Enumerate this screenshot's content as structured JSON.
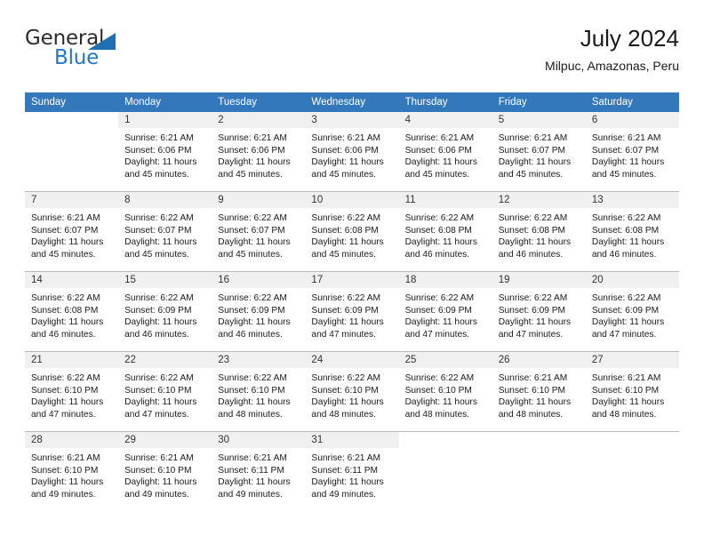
{
  "brand": {
    "name_top": "General",
    "name_bottom": "Blue",
    "triangle_color": "#1f6fb5",
    "blue_color": "#2277c8"
  },
  "header": {
    "title": "July 2024",
    "subtitle": "Milpuc, Amazonas, Peru"
  },
  "theme": {
    "header_bg": "#3478bc",
    "daynum_bg": "#f0f0f0",
    "row_divider": "#b9b9b9"
  },
  "weekday_headers": [
    "Sunday",
    "Monday",
    "Tuesday",
    "Wednesday",
    "Thursday",
    "Friday",
    "Saturday"
  ],
  "weeks": [
    {
      "days": [
        {
          "num": "",
          "empty": true,
          "sunrise": "",
          "sunset": "",
          "daylight_1": "",
          "daylight_2": ""
        },
        {
          "num": "1",
          "sunrise": "Sunrise: 6:21 AM",
          "sunset": "Sunset: 6:06 PM",
          "daylight_1": "Daylight: 11 hours",
          "daylight_2": "and 45 minutes."
        },
        {
          "num": "2",
          "sunrise": "Sunrise: 6:21 AM",
          "sunset": "Sunset: 6:06 PM",
          "daylight_1": "Daylight: 11 hours",
          "daylight_2": "and 45 minutes."
        },
        {
          "num": "3",
          "sunrise": "Sunrise: 6:21 AM",
          "sunset": "Sunset: 6:06 PM",
          "daylight_1": "Daylight: 11 hours",
          "daylight_2": "and 45 minutes."
        },
        {
          "num": "4",
          "sunrise": "Sunrise: 6:21 AM",
          "sunset": "Sunset: 6:06 PM",
          "daylight_1": "Daylight: 11 hours",
          "daylight_2": "and 45 minutes."
        },
        {
          "num": "5",
          "sunrise": "Sunrise: 6:21 AM",
          "sunset": "Sunset: 6:07 PM",
          "daylight_1": "Daylight: 11 hours",
          "daylight_2": "and 45 minutes."
        },
        {
          "num": "6",
          "sunrise": "Sunrise: 6:21 AM",
          "sunset": "Sunset: 6:07 PM",
          "daylight_1": "Daylight: 11 hours",
          "daylight_2": "and 45 minutes."
        }
      ]
    },
    {
      "days": [
        {
          "num": "7",
          "sunrise": "Sunrise: 6:21 AM",
          "sunset": "Sunset: 6:07 PM",
          "daylight_1": "Daylight: 11 hours",
          "daylight_2": "and 45 minutes."
        },
        {
          "num": "8",
          "sunrise": "Sunrise: 6:22 AM",
          "sunset": "Sunset: 6:07 PM",
          "daylight_1": "Daylight: 11 hours",
          "daylight_2": "and 45 minutes."
        },
        {
          "num": "9",
          "sunrise": "Sunrise: 6:22 AM",
          "sunset": "Sunset: 6:07 PM",
          "daylight_1": "Daylight: 11 hours",
          "daylight_2": "and 45 minutes."
        },
        {
          "num": "10",
          "sunrise": "Sunrise: 6:22 AM",
          "sunset": "Sunset: 6:08 PM",
          "daylight_1": "Daylight: 11 hours",
          "daylight_2": "and 45 minutes."
        },
        {
          "num": "11",
          "sunrise": "Sunrise: 6:22 AM",
          "sunset": "Sunset: 6:08 PM",
          "daylight_1": "Daylight: 11 hours",
          "daylight_2": "and 46 minutes."
        },
        {
          "num": "12",
          "sunrise": "Sunrise: 6:22 AM",
          "sunset": "Sunset: 6:08 PM",
          "daylight_1": "Daylight: 11 hours",
          "daylight_2": "and 46 minutes."
        },
        {
          "num": "13",
          "sunrise": "Sunrise: 6:22 AM",
          "sunset": "Sunset: 6:08 PM",
          "daylight_1": "Daylight: 11 hours",
          "daylight_2": "and 46 minutes."
        }
      ]
    },
    {
      "days": [
        {
          "num": "14",
          "sunrise": "Sunrise: 6:22 AM",
          "sunset": "Sunset: 6:08 PM",
          "daylight_1": "Daylight: 11 hours",
          "daylight_2": "and 46 minutes."
        },
        {
          "num": "15",
          "sunrise": "Sunrise: 6:22 AM",
          "sunset": "Sunset: 6:09 PM",
          "daylight_1": "Daylight: 11 hours",
          "daylight_2": "and 46 minutes."
        },
        {
          "num": "16",
          "sunrise": "Sunrise: 6:22 AM",
          "sunset": "Sunset: 6:09 PM",
          "daylight_1": "Daylight: 11 hours",
          "daylight_2": "and 46 minutes."
        },
        {
          "num": "17",
          "sunrise": "Sunrise: 6:22 AM",
          "sunset": "Sunset: 6:09 PM",
          "daylight_1": "Daylight: 11 hours",
          "daylight_2": "and 47 minutes."
        },
        {
          "num": "18",
          "sunrise": "Sunrise: 6:22 AM",
          "sunset": "Sunset: 6:09 PM",
          "daylight_1": "Daylight: 11 hours",
          "daylight_2": "and 47 minutes."
        },
        {
          "num": "19",
          "sunrise": "Sunrise: 6:22 AM",
          "sunset": "Sunset: 6:09 PM",
          "daylight_1": "Daylight: 11 hours",
          "daylight_2": "and 47 minutes."
        },
        {
          "num": "20",
          "sunrise": "Sunrise: 6:22 AM",
          "sunset": "Sunset: 6:09 PM",
          "daylight_1": "Daylight: 11 hours",
          "daylight_2": "and 47 minutes."
        }
      ]
    },
    {
      "days": [
        {
          "num": "21",
          "sunrise": "Sunrise: 6:22 AM",
          "sunset": "Sunset: 6:10 PM",
          "daylight_1": "Daylight: 11 hours",
          "daylight_2": "and 47 minutes."
        },
        {
          "num": "22",
          "sunrise": "Sunrise: 6:22 AM",
          "sunset": "Sunset: 6:10 PM",
          "daylight_1": "Daylight: 11 hours",
          "daylight_2": "and 47 minutes."
        },
        {
          "num": "23",
          "sunrise": "Sunrise: 6:22 AM",
          "sunset": "Sunset: 6:10 PM",
          "daylight_1": "Daylight: 11 hours",
          "daylight_2": "and 48 minutes."
        },
        {
          "num": "24",
          "sunrise": "Sunrise: 6:22 AM",
          "sunset": "Sunset: 6:10 PM",
          "daylight_1": "Daylight: 11 hours",
          "daylight_2": "and 48 minutes."
        },
        {
          "num": "25",
          "sunrise": "Sunrise: 6:22 AM",
          "sunset": "Sunset: 6:10 PM",
          "daylight_1": "Daylight: 11 hours",
          "daylight_2": "and 48 minutes."
        },
        {
          "num": "26",
          "sunrise": "Sunrise: 6:21 AM",
          "sunset": "Sunset: 6:10 PM",
          "daylight_1": "Daylight: 11 hours",
          "daylight_2": "and 48 minutes."
        },
        {
          "num": "27",
          "sunrise": "Sunrise: 6:21 AM",
          "sunset": "Sunset: 6:10 PM",
          "daylight_1": "Daylight: 11 hours",
          "daylight_2": "and 48 minutes."
        }
      ]
    },
    {
      "days": [
        {
          "num": "28",
          "sunrise": "Sunrise: 6:21 AM",
          "sunset": "Sunset: 6:10 PM",
          "daylight_1": "Daylight: 11 hours",
          "daylight_2": "and 49 minutes."
        },
        {
          "num": "29",
          "sunrise": "Sunrise: 6:21 AM",
          "sunset": "Sunset: 6:10 PM",
          "daylight_1": "Daylight: 11 hours",
          "daylight_2": "and 49 minutes."
        },
        {
          "num": "30",
          "sunrise": "Sunrise: 6:21 AM",
          "sunset": "Sunset: 6:11 PM",
          "daylight_1": "Daylight: 11 hours",
          "daylight_2": "and 49 minutes."
        },
        {
          "num": "31",
          "sunrise": "Sunrise: 6:21 AM",
          "sunset": "Sunset: 6:11 PM",
          "daylight_1": "Daylight: 11 hours",
          "daylight_2": "and 49 minutes."
        },
        {
          "num": "",
          "empty": true,
          "sunrise": "",
          "sunset": "",
          "daylight_1": "",
          "daylight_2": ""
        },
        {
          "num": "",
          "empty": true,
          "sunrise": "",
          "sunset": "",
          "daylight_1": "",
          "daylight_2": ""
        },
        {
          "num": "",
          "empty": true,
          "sunrise": "",
          "sunset": "",
          "daylight_1": "",
          "daylight_2": ""
        }
      ]
    }
  ]
}
